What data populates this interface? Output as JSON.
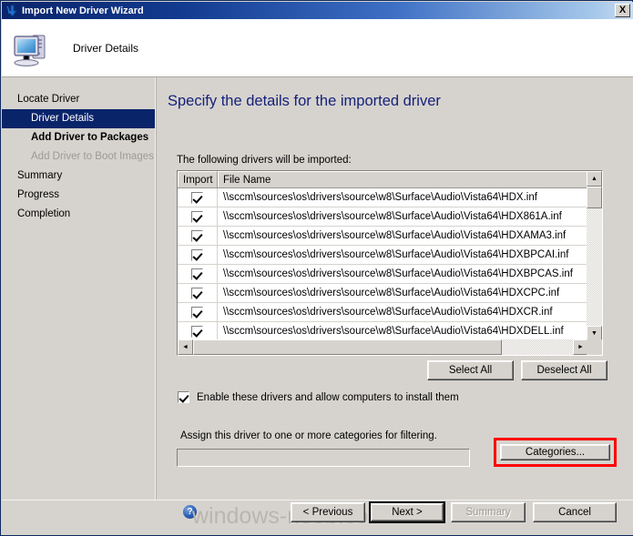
{
  "window": {
    "title": "Import New Driver Wizard",
    "title_icon": "blue-down-arrow-icon",
    "close_label": "X",
    "accent_titlebar": "#0a246a",
    "face_color": "#d6d3ce"
  },
  "header": {
    "title": "Driver Details",
    "icon": "computer-monitor-icon"
  },
  "sidebar": {
    "items": [
      {
        "label": "Locate Driver",
        "level": 0,
        "state": "normal"
      },
      {
        "label": "Driver Details",
        "level": 1,
        "state": "selected"
      },
      {
        "label": "Add Driver to Packages",
        "level": 1,
        "state": "bold"
      },
      {
        "label": "Add Driver to Boot Images",
        "level": 1,
        "state": "disabled"
      },
      {
        "label": "Summary",
        "level": 0,
        "state": "normal"
      },
      {
        "label": "Progress",
        "level": 0,
        "state": "normal"
      },
      {
        "label": "Completion",
        "level": 0,
        "state": "normal"
      }
    ],
    "scrollbar": {
      "left_arrow": "◄",
      "right_arrow": "►"
    }
  },
  "main": {
    "page_title": "Specify the details for the imported driver",
    "list_label": "The following drivers will be imported:",
    "columns": [
      "Import",
      "File Name"
    ],
    "rows": [
      {
        "import": true,
        "file": "\\\\sccm\\sources\\os\\drivers\\source\\w8\\Surface\\Audio\\Vista64\\HDX.inf"
      },
      {
        "import": true,
        "file": "\\\\sccm\\sources\\os\\drivers\\source\\w8\\Surface\\Audio\\Vista64\\HDX861A.inf"
      },
      {
        "import": true,
        "file": "\\\\sccm\\sources\\os\\drivers\\source\\w8\\Surface\\Audio\\Vista64\\HDXAMA3.inf"
      },
      {
        "import": true,
        "file": "\\\\sccm\\sources\\os\\drivers\\source\\w8\\Surface\\Audio\\Vista64\\HDXBPCAI.inf"
      },
      {
        "import": true,
        "file": "\\\\sccm\\sources\\os\\drivers\\source\\w8\\Surface\\Audio\\Vista64\\HDXBPCAS.inf"
      },
      {
        "import": true,
        "file": "\\\\sccm\\sources\\os\\drivers\\source\\w8\\Surface\\Audio\\Vista64\\HDXCPC.inf"
      },
      {
        "import": true,
        "file": "\\\\sccm\\sources\\os\\drivers\\source\\w8\\Surface\\Audio\\Vista64\\HDXCR.inf"
      },
      {
        "import": true,
        "file": "\\\\sccm\\sources\\os\\drivers\\source\\w8\\Surface\\Audio\\Vista64\\HDXDELL.inf"
      }
    ],
    "scrollbar": {
      "up_arrow": "▲",
      "down_arrow": "▼",
      "left_arrow": "◄",
      "right_arrow": "►"
    },
    "select_all_label": "Select All",
    "deselect_all_label": "Deselect All",
    "enable_checkbox": {
      "checked": true,
      "label": "Enable these drivers and allow computers to install them"
    },
    "assign_label": "Assign this driver to one or more categories for filtering.",
    "categories_value": "",
    "categories_button_label": "Categories...",
    "highlight_color": "#ff0000"
  },
  "footer": {
    "help_glyph": "?",
    "watermark": "windows-noob.com",
    "previous_label": "< Previous",
    "next_label": "Next >",
    "summary_label": "Summary",
    "cancel_label": "Cancel"
  }
}
